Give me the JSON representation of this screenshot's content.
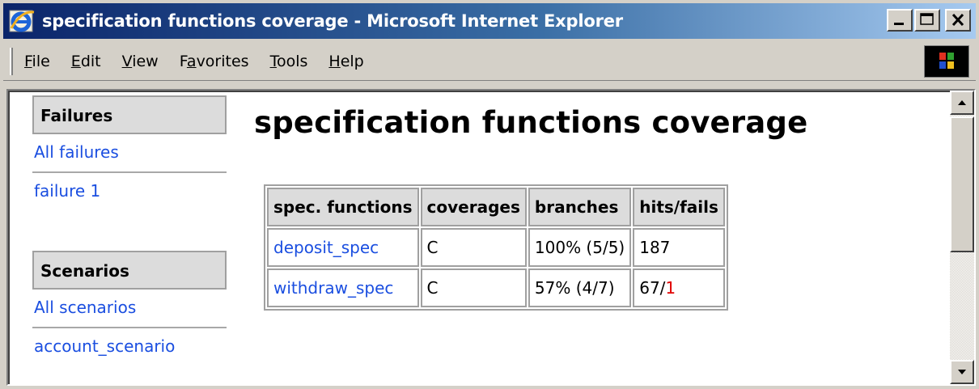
{
  "window": {
    "title": "specification functions coverage - Microsoft Internet Explorer",
    "icon": "ie-icon",
    "buttons": [
      "minimize",
      "maximize",
      "close"
    ]
  },
  "menubar": {
    "items": [
      {
        "key": "F",
        "rest": "ile"
      },
      {
        "key": "E",
        "rest": "dit"
      },
      {
        "key": "V",
        "rest": "iew"
      },
      {
        "pre": "F",
        "key": "a",
        "rest": "vorites"
      },
      {
        "key": "T",
        "rest": "ools"
      },
      {
        "key": "H",
        "rest": "elp"
      }
    ]
  },
  "sidebar": {
    "failures": {
      "header": "Failures",
      "links": [
        "All failures",
        "failure 1"
      ]
    },
    "scenarios": {
      "header": "Scenarios",
      "links": [
        "All scenarios",
        "account_scenario"
      ]
    }
  },
  "main": {
    "title": "specification functions coverage",
    "table": {
      "headers": [
        "spec. functions",
        "coverages",
        "branches",
        "hits/fails"
      ],
      "rows": [
        {
          "function": "deposit_spec",
          "coverage": "C",
          "branches": "100% (5/5)",
          "hits": "187",
          "fails": ""
        },
        {
          "function": "withdraw_spec",
          "coverage": "C",
          "branches": "57% (4/7)",
          "hits": "67/",
          "fails": "1"
        }
      ]
    }
  },
  "colors": {
    "titlebar_start": "#0a246a",
    "titlebar_end": "#a6caf0",
    "link": "#1a4ee0",
    "fail": "#e00000",
    "header_bg": "#dcdcdc"
  }
}
